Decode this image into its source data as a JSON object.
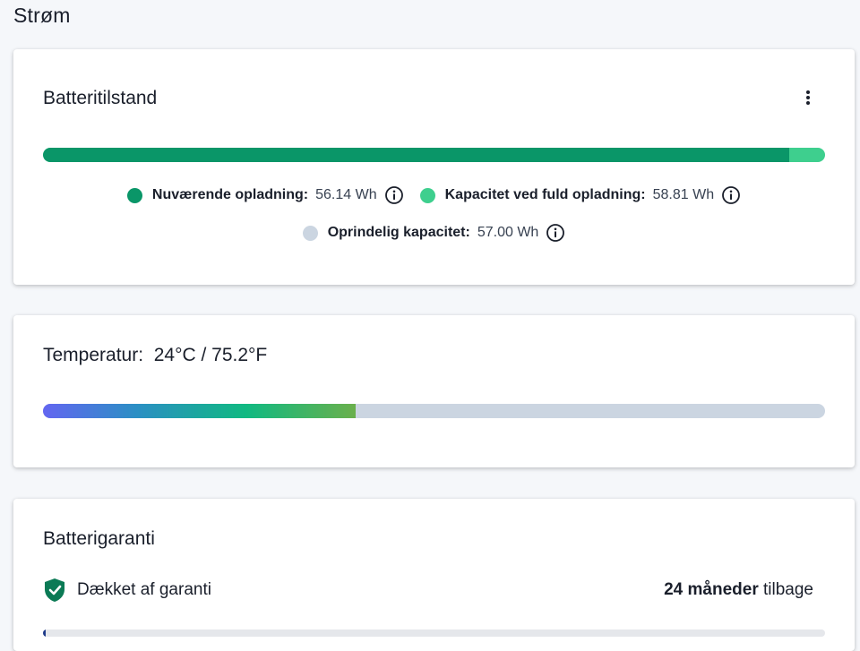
{
  "page": {
    "title": "Strøm"
  },
  "battery": {
    "heading": "Batteritilstand",
    "charge_fraction": 0.9546,
    "legend": [
      {
        "label": "Nuværende opladning:",
        "value": "56.14 Wh",
        "color": "#0a9668"
      },
      {
        "label": "Kapacitet ved fuld opladning:",
        "value": "58.81 Wh",
        "color": "#3ecf8e"
      },
      {
        "label": "Oprindelig kapacitet:",
        "value": "57.00 Wh",
        "color": "#cbd5e1"
      }
    ],
    "icons": {
      "more": "more-vertical-icon",
      "info": "info-icon"
    }
  },
  "temperature": {
    "heading": "Temperatur:",
    "value": "24°C / 75.2°F",
    "level_fraction": 0.4
  },
  "warranty": {
    "heading": "Batterigaranti",
    "status": "Dækket af garanti",
    "remaining_strong": "24 måneder",
    "remaining_rest": " tilbage",
    "icon": "shield-check-icon",
    "accent": "#0b7a55",
    "elapsed_fraction": 0.003
  }
}
